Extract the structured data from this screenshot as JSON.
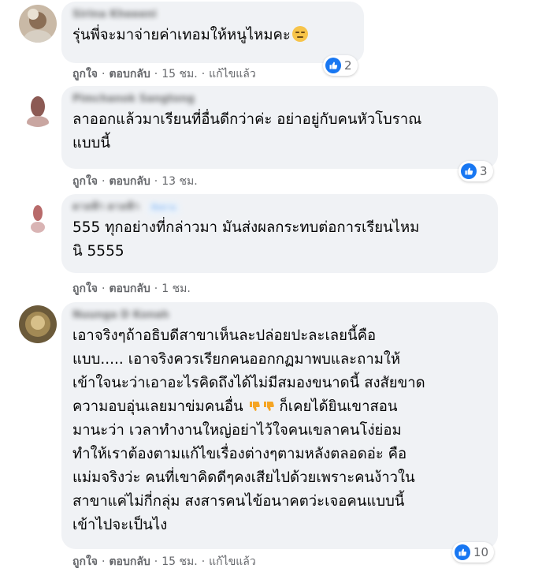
{
  "comments": [
    {
      "author": "Sirina Kheeeni",
      "badge": "",
      "text": "รุ่นพี่จะมาจ่ายค่าเทอมให้หนูไหมคะ",
      "emoji": "expressionless-face",
      "reaction_count": "2",
      "like_label": "ถูกใจ",
      "reply_label": "ตอบกลับ",
      "time": "15 ชม.",
      "edited": "แก้ไขแล้ว"
    },
    {
      "author": "Pimchanok Sangtong",
      "badge": "",
      "text": "ลาออกแล้วมาเรียนที่อื่นดีกว่าค่ะ อย่าอยู่กับคนหัวโบราณ\nแบบนี้",
      "emoji": "",
      "reaction_count": "3",
      "like_label": "ถูกใจ",
      "reply_label": "ตอบกลับ",
      "time": "13 ชม.",
      "edited": ""
    },
    {
      "author": "ดาลฟ้า ดาลฟ้า",
      "badge": "ติดตาม",
      "text": "555 ทุกอย่างที่กล่าวมา มันส่งผลกระทบต่อการเรียนไหม\nนิ 5555",
      "emoji": "",
      "reaction_count": "",
      "like_label": "ถูกใจ",
      "reply_label": "ตอบกลับ",
      "time": "1 ชม.",
      "edited": ""
    },
    {
      "author": "Nuunga D Konah",
      "badge": "",
      "text_part1": "เอาจริงๆถ้าอธิบดีสาขาเห็นละปล่อยปะละเลยนี้คือ\nแบบ..... เอาจริงควรเรียกคนออกกฏมาพบและถามให้\nเข้าใจนะว่าเอาอะไรคิดถึงได้ไม่มีสมองขนาดนี้ สงสัยขาด\nความอบอุ่นเลยมาข่มคนอื่น",
      "emoji_icons": [
        "thumbs-down-icon",
        "thumbs-down-icon"
      ],
      "text_part2": " ก็เคยได้ยินเขาสอน\nมานะว่า เวลาทำงานใหญ่อย่าไว้ใจคนเขลาคนโง่ย่อม\nทำให้เราต้องตามแก้ไขเรื่องต่างๆตามหลังตลอดอ่ะ คือ\nแม่มจริงว่ะ คนที่เขาคิดดีๆคงเสียไปด้วยเพราะคนง้าวใน\nสาขาแค่ไม่กี่กลุ่ม สงสารคนไข้อนาคตว่ะเจอคนแบบนี้\nเข้าไปจะเป็นไง",
      "reaction_count": "10",
      "like_label": "ถูกใจ",
      "reply_label": "ตอบกลับ",
      "time": "15 ชม.",
      "edited": "แก้ไขแล้ว"
    }
  ],
  "colors": {
    "bubble": "#f0f2f5",
    "like_blue": "#1877f2",
    "meta_gray": "#65676b",
    "text": "#050505"
  },
  "icons": {
    "reaction": "like-icon",
    "emoji_face": "expressionless-face-icon",
    "emoji_thumbs_down": "thumbs-down-icon"
  }
}
